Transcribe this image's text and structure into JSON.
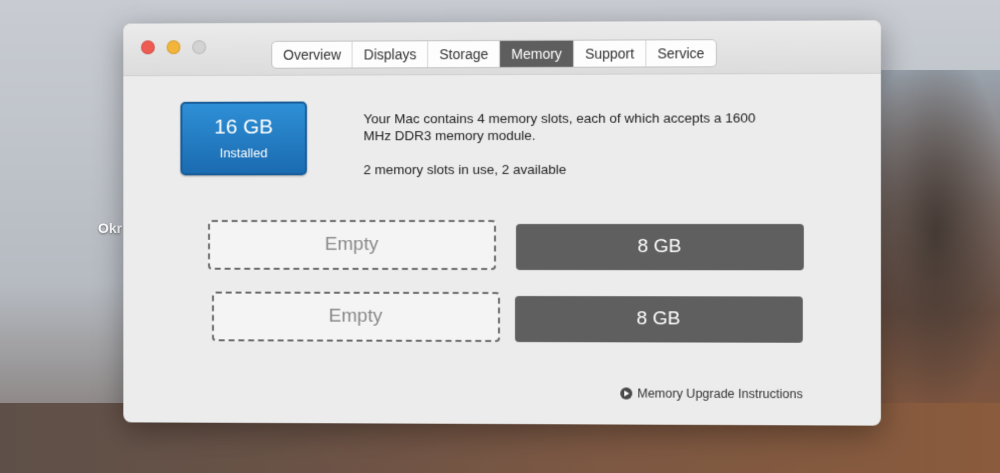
{
  "desktop": {
    "label": "Okr"
  },
  "window": {
    "tabs": [
      {
        "label": "Overview"
      },
      {
        "label": "Displays"
      },
      {
        "label": "Storage"
      },
      {
        "label": "Memory"
      },
      {
        "label": "Support"
      },
      {
        "label": "Service"
      }
    ],
    "active_tab": "Memory",
    "badge": {
      "size": "16 GB",
      "label": "Installed"
    },
    "description": "Your Mac contains 4 memory slots, each of which accepts a 1600 MHz DDR3 memory module.",
    "slots_status": "2 memory slots in use, 2 available",
    "slots": [
      {
        "label": "Empty",
        "state": "empty"
      },
      {
        "label": "8 GB",
        "state": "filled"
      },
      {
        "label": "Empty",
        "state": "empty"
      },
      {
        "label": "8 GB",
        "state": "filled"
      }
    ],
    "link": {
      "label": "Memory Upgrade Instructions"
    }
  },
  "colors": {
    "badge": "#1f78c4",
    "filled_slot": "#5f5f5f",
    "active_tab": "#5e5e5e"
  }
}
